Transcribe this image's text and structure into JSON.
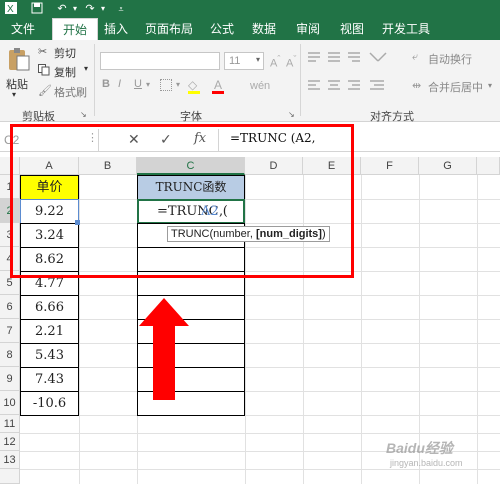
{
  "ribbon_tabs": [
    "文件",
    "开始",
    "插入",
    "页面布局",
    "公式",
    "数据",
    "审阅",
    "视图",
    "开发工具"
  ],
  "clipboard": {
    "paste": "粘贴",
    "cut": "剪切",
    "copy": "复制",
    "format_painter": "格式刷",
    "group": "剪贴板"
  },
  "font": {
    "size": "11",
    "bold": "B",
    "italic": "I",
    "underline": "U",
    "group": "字体"
  },
  "alignment": {
    "wrap": "自动换行",
    "merge": "合并后居中",
    "group": "对齐方式"
  },
  "formula_bar": {
    "name_box": "C2",
    "cancel": "✕",
    "enter": "✓",
    "fx": "fx",
    "formula": "=TRUNC (A2,"
  },
  "columns": [
    "A",
    "B",
    "C",
    "D",
    "E",
    "F",
    "G"
  ],
  "rows": [
    "1",
    "2",
    "3",
    "4",
    "5",
    "6",
    "7",
    "8",
    "9",
    "10",
    "11",
    "12",
    "13"
  ],
  "sheet": {
    "header_a": "单价",
    "header_c": "TRUNC函数",
    "values_a": [
      "9.22",
      "3.24",
      "8.62",
      "4.77",
      "6.66",
      "2.21",
      "5.43",
      "7.43",
      "-10.6"
    ],
    "editing_prefix": "=TRUNC (",
    "editing_ref": "A2",
    "editing_suffix": ","
  },
  "tooltip": {
    "func": "TRUNC(number, ",
    "arg": "[num_digits]",
    "close": ")"
  },
  "watermark": {
    "main": "Baidu经验",
    "sub": "jingyan.baidu.com"
  },
  "colors": {
    "excel_green": "#217346",
    "header_fill_a": "#ffff00",
    "header_fill_c": "#b8cce4",
    "highlight": "#ff0000",
    "arrow": "#ff0000"
  }
}
